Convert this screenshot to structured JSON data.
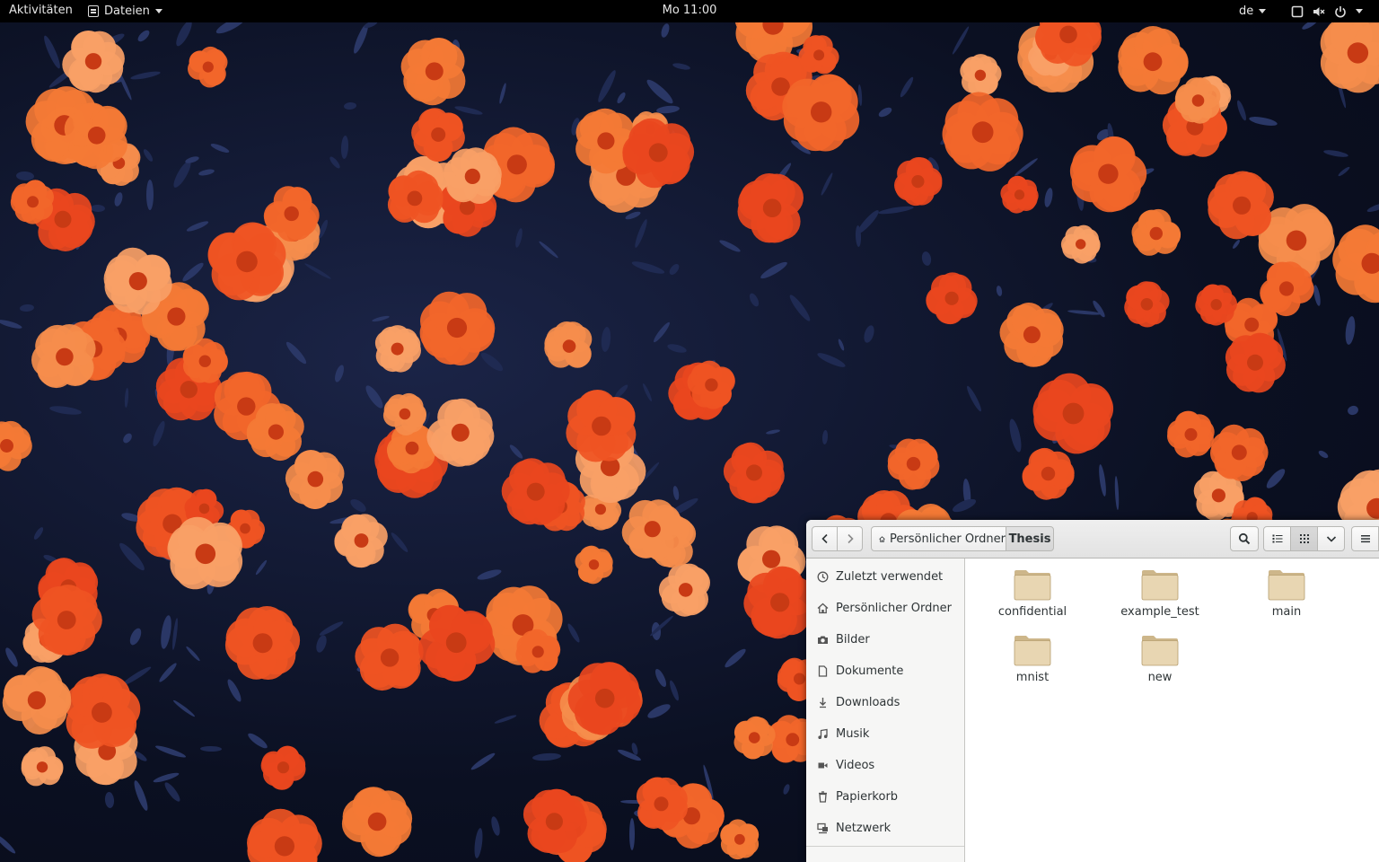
{
  "topbar": {
    "activities": "Aktivitäten",
    "app_menu": "Dateien",
    "clock": "Mo 11:00",
    "keyboard_layout": "de"
  },
  "file_manager": {
    "path": {
      "home": "Persönlicher Ordner",
      "current": "Thesis"
    },
    "view_mode": "grid",
    "sidebar": {
      "items": [
        {
          "label": "Zuletzt verwendet",
          "icon": "clock-icon"
        },
        {
          "label": "Persönlicher Ordner",
          "icon": "home-icon"
        },
        {
          "label": "Bilder",
          "icon": "camera-icon"
        },
        {
          "label": "Dokumente",
          "icon": "document-icon"
        },
        {
          "label": "Downloads",
          "icon": "download-icon"
        },
        {
          "label": "Musik",
          "icon": "music-icon"
        },
        {
          "label": "Videos",
          "icon": "video-icon"
        },
        {
          "label": "Papierkorb",
          "icon": "trash-icon"
        },
        {
          "label": "Netzwerk",
          "icon": "network-icon"
        }
      ]
    },
    "folders": [
      {
        "name": "confidential"
      },
      {
        "name": "example_test"
      },
      {
        "name": "main"
      },
      {
        "name": "mnist"
      },
      {
        "name": "new"
      }
    ]
  },
  "colors": {
    "topbar_bg": "#000000",
    "flower_orange": "#f2662a",
    "foliage_navy": "#1b2447",
    "folder_tan": "#e8d6b2"
  }
}
